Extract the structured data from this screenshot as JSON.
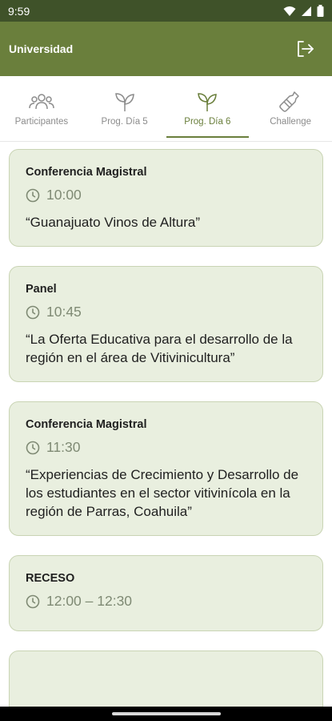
{
  "status": {
    "time": "9:59"
  },
  "app": {
    "title": "Universidad"
  },
  "tabs": [
    {
      "label": "Participantes",
      "icon": "people-icon",
      "active": false
    },
    {
      "label": "Prog. Día 5",
      "icon": "sprout-icon",
      "active": false
    },
    {
      "label": "Prog. Día 6",
      "icon": "sprout-icon",
      "active": true
    },
    {
      "label": "Challenge",
      "icon": "wine-bottle-icon",
      "active": false
    }
  ],
  "events": [
    {
      "type": "Conferencia Magistral",
      "time": "10:00",
      "title": "“Guanajuato Vinos de Altura”"
    },
    {
      "type": "Panel",
      "time": "10:45",
      "title": "“La Oferta Educativa para el desarrollo de la región en el área de Vitivinicultura”"
    },
    {
      "type": "Conferencia Magistral",
      "time": "11:30",
      "title": "“Experiencias de Crecimiento y Desarrollo  de los estudiantes en el sector vitivinícola en la región de Parras, Coahuila”"
    },
    {
      "type": "RECESO",
      "time": "12:00 – 12:30",
      "title": ""
    }
  ],
  "colors": {
    "primary": "#6a7f3c",
    "statusBar": "#3f5229",
    "cardBg": "#e9efdf",
    "cardBorder": "#c9d4b4"
  }
}
